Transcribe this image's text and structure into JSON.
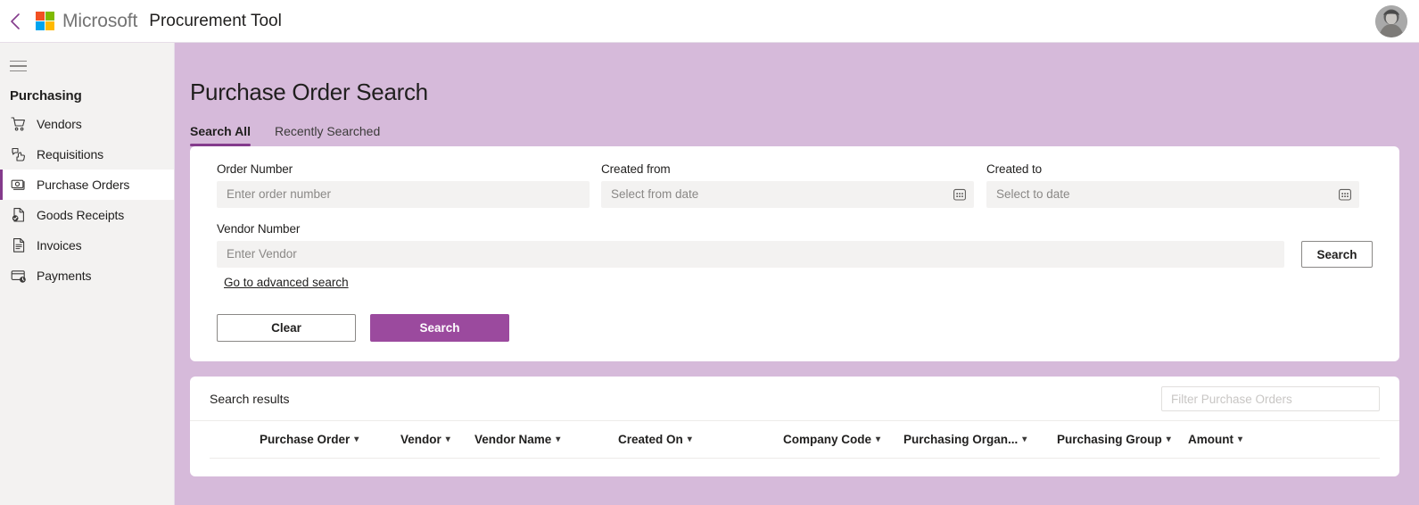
{
  "topbar": {
    "back_icon": "chevron-left-icon",
    "brand_microsoft": "Microsoft",
    "app_title": "Procurement Tool",
    "avatar_label": "User avatar"
  },
  "sidebar": {
    "menu_icon": "hamburger-menu-icon",
    "section_title": "Purchasing",
    "items": [
      {
        "label": "Vendors",
        "icon": "shopping-cart-icon",
        "active": false
      },
      {
        "label": "Requisitions",
        "icon": "approvals-icon",
        "active": false
      },
      {
        "label": "Purchase Orders",
        "icon": "money-icon",
        "active": true
      },
      {
        "label": "Goods Receipts",
        "icon": "document-check-icon",
        "active": false
      },
      {
        "label": "Invoices",
        "icon": "document-lines-icon",
        "active": false
      },
      {
        "label": "Payments",
        "icon": "card-clock-icon",
        "active": false
      }
    ]
  },
  "main": {
    "page_title": "Purchase Order Search",
    "tabs": [
      {
        "label": "Search All",
        "active": true
      },
      {
        "label": "Recently Searched",
        "active": false
      }
    ],
    "form": {
      "order_number": {
        "label": "Order Number",
        "placeholder": "Enter order number",
        "value": ""
      },
      "created_from": {
        "label": "Created from",
        "placeholder": "Select from date",
        "value": "",
        "icon": "calendar-icon"
      },
      "created_to": {
        "label": "Created to",
        "placeholder": "Select to date",
        "value": "",
        "icon": "calendar-icon"
      },
      "vendor_number": {
        "label": "Vendor Number",
        "placeholder": "Enter Vendor",
        "value": ""
      },
      "vendor_search_button": "Search",
      "advanced_link": "Go to advanced search",
      "clear_button": "Clear",
      "search_button": "Search"
    },
    "results": {
      "title": "Search results",
      "filter_placeholder": "Filter Purchase Orders",
      "filter_value": "",
      "columns": [
        {
          "label": "Purchase Order",
          "sortable": true
        },
        {
          "label": "Vendor",
          "sortable": true
        },
        {
          "label": "Vendor Name",
          "sortable": true
        },
        {
          "label": "Created On",
          "sortable": true
        },
        {
          "label": "Company Code",
          "sortable": true
        },
        {
          "label": "Purchasing Organ...",
          "sortable": true
        },
        {
          "label": "Purchasing Group",
          "sortable": true
        },
        {
          "label": "Amount",
          "sortable": true
        }
      ],
      "rows": []
    }
  },
  "colors": {
    "accent_purple": "#843b8c",
    "primary_button": "#9b4a9e",
    "page_background": "#d6bada",
    "sidebar_background": "#f3f2f1",
    "input_background": "#f3f2f1"
  }
}
